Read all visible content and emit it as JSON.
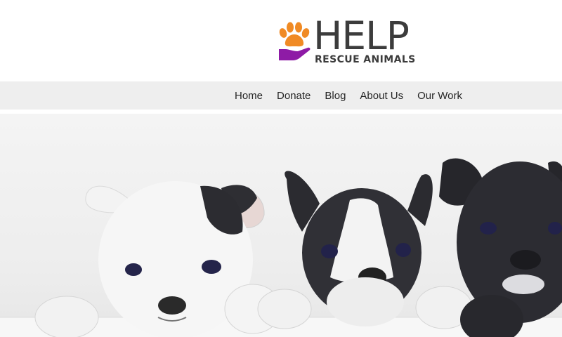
{
  "logo": {
    "title": "HELP",
    "subtitle": "RESCUE ANIMALS",
    "icon": "paw-in-hand-icon",
    "colors": {
      "paw": "#f08a24",
      "hand": "#8e1ba6",
      "text": "#3c3c3c"
    }
  },
  "nav": {
    "items": [
      {
        "label": "Home"
      },
      {
        "label": "Donate"
      },
      {
        "label": "Blog"
      },
      {
        "label": "About Us"
      },
      {
        "label": "Our Work"
      }
    ]
  },
  "hero": {
    "image": "three-french-bulldog-puppies-photo",
    "puppies": [
      "white-puppy",
      "black-and-white-puppy",
      "black-puppy"
    ]
  }
}
